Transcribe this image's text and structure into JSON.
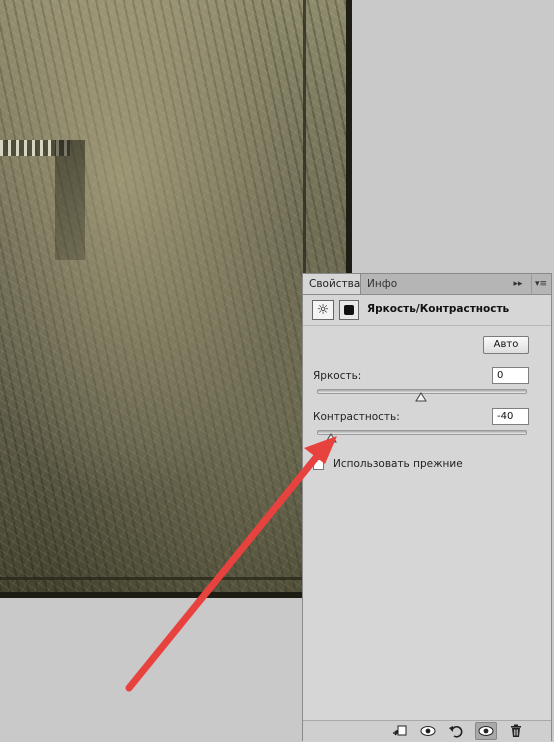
{
  "panel": {
    "tabs": [
      {
        "label": "Свойства",
        "active": true
      },
      {
        "label": "Инфо",
        "active": false
      }
    ],
    "collapse_glyph": "▸▸",
    "menu_glyph": "▾≡",
    "header": {
      "title": "Яркость/Контрастность",
      "adjustment_icon": "sun-brightness-icon",
      "mask_icon": "layer-mask-icon"
    },
    "auto_button": "Авто",
    "brightness": {
      "label": "Яркость:",
      "value": "0",
      "range": [
        -150,
        150
      ]
    },
    "contrast": {
      "label": "Контрастность:",
      "value": "-40",
      "range": [
        -50,
        100
      ]
    },
    "legacy_checkbox": {
      "label": "Использовать прежние",
      "checked": false
    },
    "bottom_icons": [
      "clip-to-layer-icon",
      "view-previous-icon",
      "reset-icon",
      "visibility-eye-icon",
      "trash-icon"
    ]
  },
  "annotation": {
    "type": "red-arrow",
    "color": "#e8423f"
  }
}
